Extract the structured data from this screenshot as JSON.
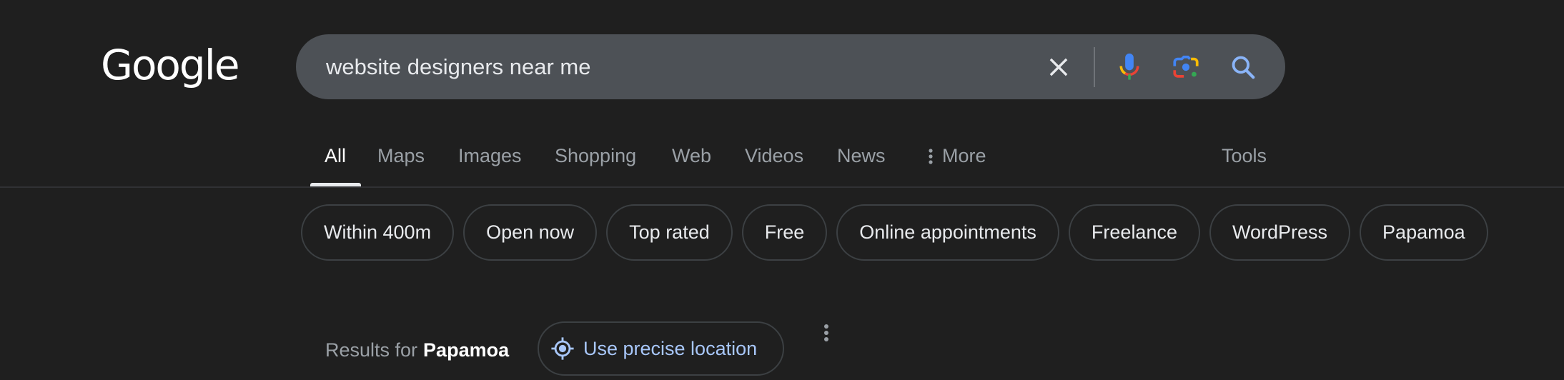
{
  "header": {
    "logo_text": "Google",
    "search": {
      "value": "website designers near me",
      "clear_icon": "close-icon",
      "voice_icon": "microphone-icon",
      "lens_icon": "google-lens-icon",
      "search_icon": "search-icon"
    }
  },
  "tabs": [
    {
      "label": "All",
      "active": true
    },
    {
      "label": "Maps"
    },
    {
      "label": "Images"
    },
    {
      "label": "Shopping"
    },
    {
      "label": "Web"
    },
    {
      "label": "Videos"
    },
    {
      "label": "News"
    },
    {
      "label": "More",
      "icon": "kebab-vertical-icon"
    }
  ],
  "tools_label": "Tools",
  "filter_chips": [
    "Within 400m",
    "Open now",
    "Top rated",
    "Free",
    "Online appointments",
    "Freelance",
    "WordPress",
    "Papamoa"
  ],
  "location": {
    "results_for_label": "Results for",
    "place": "Papamoa",
    "precise_button": "Use precise location",
    "precise_icon": "my-location-icon",
    "menu_icon": "kebab-vertical-icon"
  },
  "colors": {
    "background": "#1f1f1f",
    "searchbar": "#4d5156",
    "link_blue": "#a8c7fa",
    "muted_text": "#9aa0a6"
  }
}
